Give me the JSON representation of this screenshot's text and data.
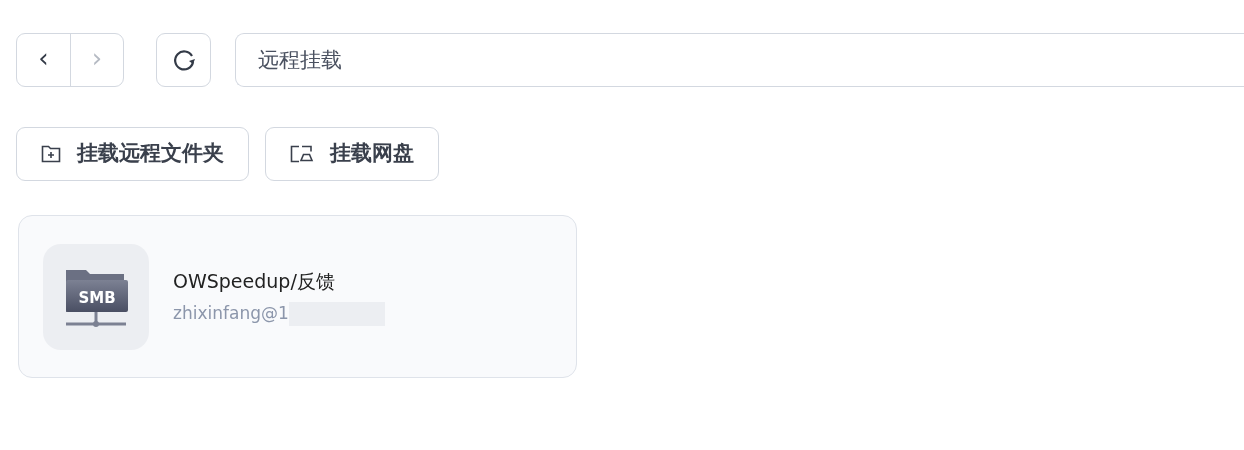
{
  "toolbar": {
    "back": {
      "label": "‹",
      "disabled": false
    },
    "forward": {
      "label": "›",
      "disabled": true
    },
    "address": {
      "value": "远程挂载"
    }
  },
  "actions": [
    {
      "kind": "folder-plus",
      "label": "挂载远程文件夹"
    },
    {
      "kind": "cloud-folder",
      "label": "挂载网盘"
    }
  ],
  "mounts": [
    {
      "icon_label": "SMB",
      "name": "OWSpeedup/反馈",
      "account": "zhixinfang@1"
    }
  ]
}
